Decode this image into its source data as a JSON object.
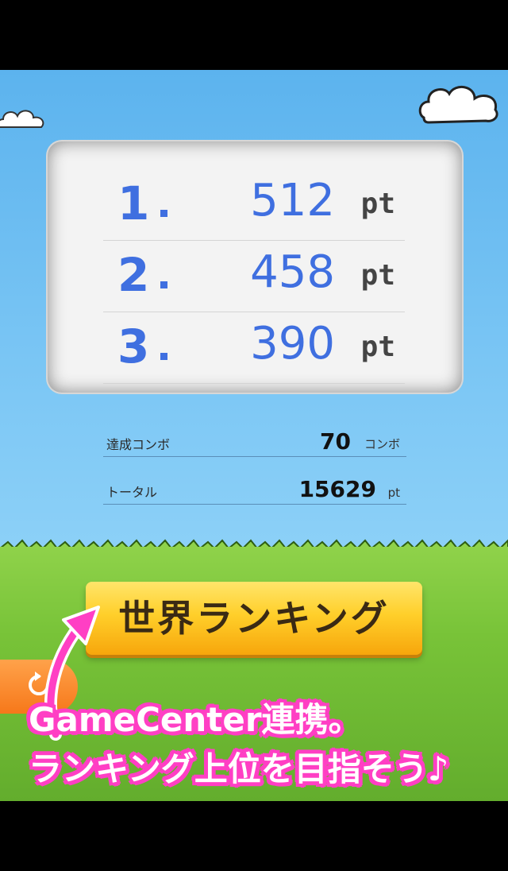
{
  "ranking": [
    {
      "rank": "1",
      "score": "512",
      "unit": "pt"
    },
    {
      "rank": "2",
      "score": "458",
      "unit": "pt"
    },
    {
      "rank": "3",
      "score": "390",
      "unit": "pt"
    }
  ],
  "stats": {
    "combo_label": "達成コンボ",
    "combo_value": "70",
    "combo_unit": "コンボ",
    "total_label": "トータル",
    "total_value": "15629",
    "total_unit": "pt"
  },
  "buttons": {
    "world_ranking_label": "世界ランキング"
  },
  "promo": {
    "line1": "GameCenter連携。",
    "line2": "ランキング上位を目指そう♪"
  },
  "icons": {
    "back": "replay-arrow-icon",
    "pointer": "curved-arrow-icon",
    "cloud": "cloud-icon"
  },
  "colors": {
    "sky": "#7ec8f5",
    "grass": "#78c338",
    "rank_blue": "#3f6fe0",
    "button_yellow": "#ffcf2a",
    "back_orange": "#f6781a",
    "promo_pink": "#ff3fc4"
  }
}
